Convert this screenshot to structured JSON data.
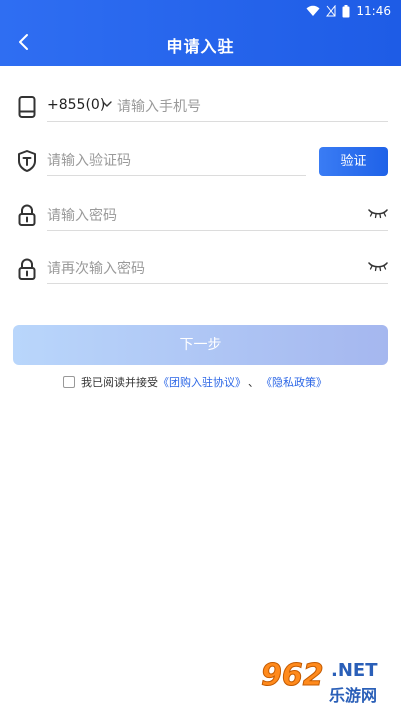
{
  "status_bar": {
    "time": "11:46"
  },
  "header": {
    "title": "申请入驻"
  },
  "form": {
    "phone": {
      "country_code": "+855(0)",
      "placeholder": "请输入手机号",
      "value": ""
    },
    "code": {
      "placeholder": "请输入验证码",
      "value": "",
      "send_label": "验证"
    },
    "password": {
      "placeholder": "请输入密码",
      "value": ""
    },
    "confirm_password": {
      "placeholder": "请再次输入密码",
      "value": ""
    }
  },
  "next_button": {
    "label": "下一步"
  },
  "agreement": {
    "prefix": "我已阅读并接受",
    "link1": "《团购入驻协议》",
    "separator": "、",
    "link2": "《隐私政策》"
  },
  "watermark": {
    "number": "962",
    "suffix": ".NET",
    "text": "乐游网"
  },
  "colors": {
    "primary": "#1e5ce6",
    "button_disabled_start": "#b9d6fb",
    "button_disabled_end": "#a5b7ef",
    "link": "#2b66e6"
  },
  "icons": [
    "wifi-icon",
    "signal-icon",
    "battery-icon",
    "back-arrow-icon",
    "phone-icon",
    "shield-icon",
    "lock-icon",
    "eye-closed-icon",
    "chevron-down-icon"
  ]
}
